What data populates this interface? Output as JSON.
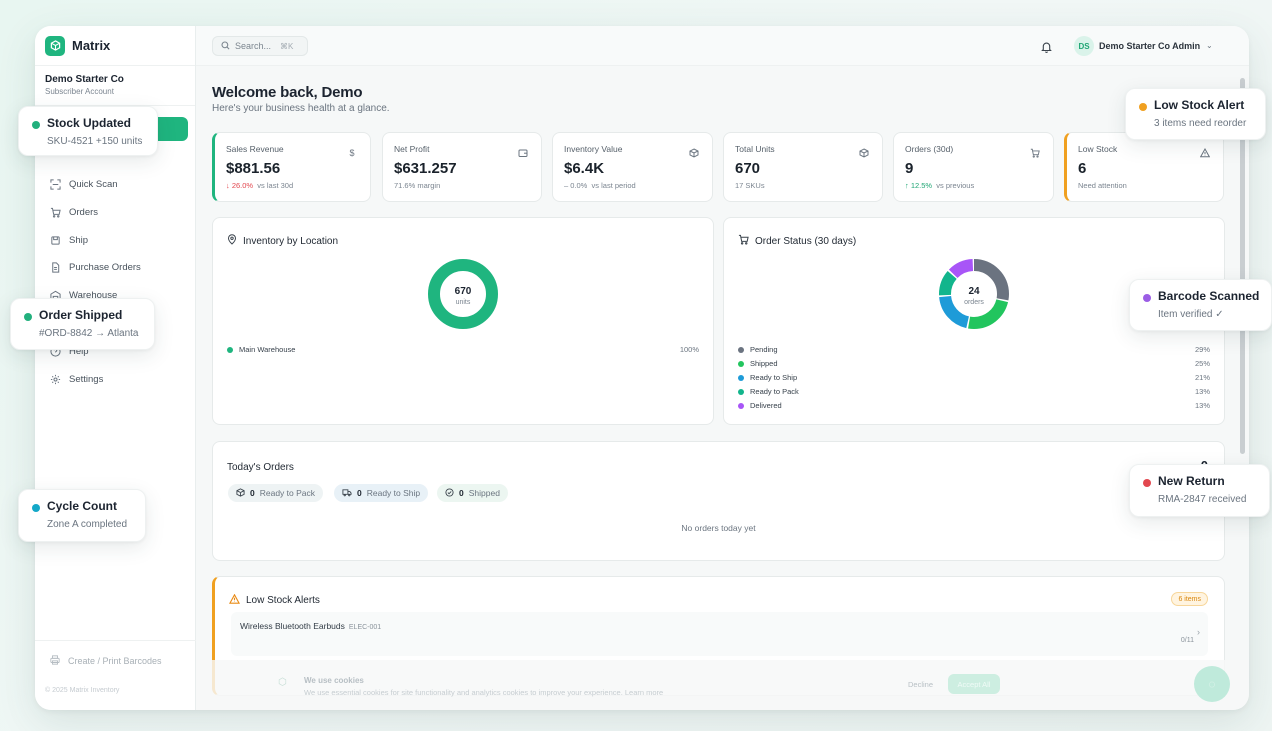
{
  "app": {
    "name": "Matrix"
  },
  "company": {
    "name": "Demo Starter Co",
    "plan": "Subscriber Account"
  },
  "sidebar": {
    "items": [
      {
        "label": "Quick Scan",
        "icon": "scan-icon"
      },
      {
        "label": "Orders",
        "icon": "cart-icon"
      },
      {
        "label": "Ship",
        "icon": "truck-icon"
      },
      {
        "label": "Purchase Orders",
        "icon": "document-icon"
      },
      {
        "label": "Warehouse",
        "icon": "warehouse-icon"
      },
      {
        "label": "Help",
        "icon": "help-icon"
      },
      {
        "label": "Settings",
        "icon": "gear-icon"
      }
    ],
    "bottom_label": "Create / Print Barcodes",
    "copyright": "© 2025 Matrix Inventory"
  },
  "topbar": {
    "search_placeholder": "Search...",
    "search_shortcut": "⌘K",
    "user_initials": "DS",
    "user_name": "Demo Starter Co Admin"
  },
  "welcome": {
    "title": "Welcome back, Demo",
    "subtitle": "Here's your business health at a glance."
  },
  "stats": [
    {
      "label": "Sales Revenue",
      "value": "$881.56",
      "change": "↓ 26.0%",
      "meta": "vs last 30d",
      "icon": "$"
    },
    {
      "label": "Net Profit",
      "value": "$631.257",
      "meta": "71.6% margin"
    },
    {
      "label": "Inventory Value",
      "value": "$6.4K",
      "change": "– 0.0%",
      "meta": "vs last period"
    },
    {
      "label": "Total Units",
      "value": "670",
      "meta": "17 SKUs"
    },
    {
      "label": "Orders (30d)",
      "value": "9",
      "change": "↑ 12.5%",
      "meta": "vs previous"
    },
    {
      "label": "Low Stock",
      "value": "6",
      "meta": "Need attention"
    }
  ],
  "inventory_location": {
    "title": "Inventory by Location",
    "center_value": "670",
    "center_label": "units",
    "rows": [
      {
        "name": "Main Warehouse",
        "pct": "100%",
        "value": 100,
        "color": "#1fb57f"
      }
    ]
  },
  "order_status": {
    "title": "Order Status (30 days)",
    "center_value": "24",
    "center_label": "orders",
    "rows": [
      {
        "name": "Pending",
        "pct": "29%",
        "value": 29,
        "color": "#6b7380"
      },
      {
        "name": "Shipped",
        "pct": "25%",
        "value": 25,
        "color": "#22c55e"
      },
      {
        "name": "Ready to Ship",
        "pct": "21%",
        "value": 21,
        "color": "#1e9bd8"
      },
      {
        "name": "Ready to Pack",
        "pct": "13%",
        "value": 13,
        "color": "#12b58c"
      },
      {
        "name": "Delivered",
        "pct": "13%",
        "value": 13,
        "color": "#a855f7"
      }
    ]
  },
  "todays_orders": {
    "title": "Today's Orders",
    "count": "0",
    "pills": [
      {
        "count": "0",
        "label": "Ready to Pack"
      },
      {
        "count": "0",
        "label": "Ready to Ship"
      },
      {
        "count": "0",
        "label": "Shipped"
      }
    ],
    "empty": "No orders today yet"
  },
  "low_stock": {
    "title": "Low Stock Alerts",
    "badge": "6 items",
    "item_name": "Wireless Bluetooth Earbuds",
    "item_sku": "ELEC-001",
    "item_qty": "0/11"
  },
  "cookie": {
    "title": "We use cookies",
    "text": "We use essential cookies for site functionality and analytics cookies to improve your experience. Learn more",
    "decline": "Decline",
    "accept": "Accept All"
  },
  "toasts": [
    {
      "title": "Stock Updated",
      "text": "SKU-4521 +150 units",
      "color": "#22b07d"
    },
    {
      "title": "Order Shipped",
      "text": "#ORD-8842 → Atlanta",
      "color": "#22b07d"
    },
    {
      "title": "Cycle Count",
      "text": "Zone A completed",
      "color": "#14a8c8"
    },
    {
      "title": "Low Stock Alert",
      "text": "3 items need reorder",
      "color": "#f0a020"
    },
    {
      "title": "Barcode Scanned",
      "text": "Item verified ✓",
      "color": "#9b5de5"
    },
    {
      "title": "New Return",
      "text": "RMA-2847 received",
      "color": "#e2474f"
    }
  ]
}
